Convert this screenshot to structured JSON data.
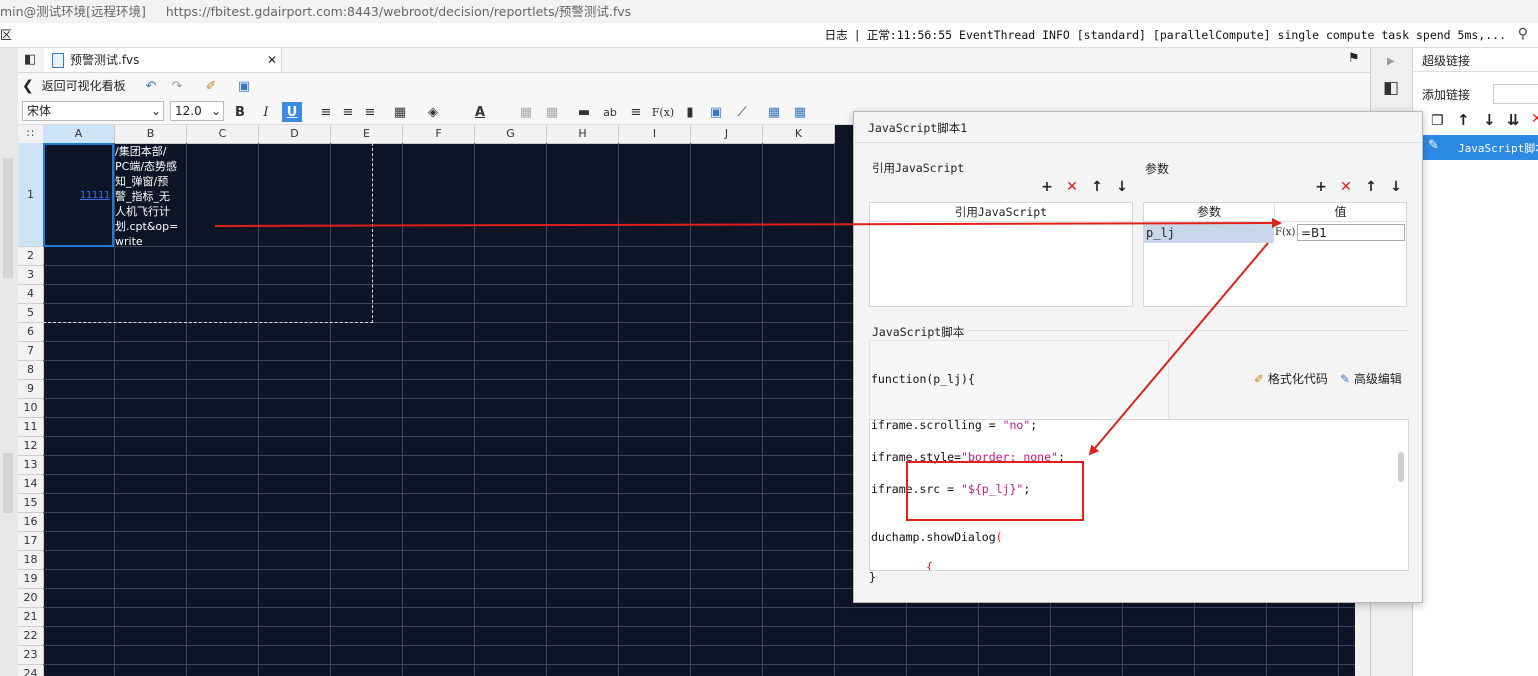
{
  "browser": {
    "title": "min@测试环境[远程环境]",
    "url": "https://fbitest.gdairport.com:8443/webroot/decision/reportlets/预警测试.fvs"
  },
  "titlebar": {
    "left_char": "区",
    "log_label": "日志",
    "log_text": "正常:11:56:55 EventThread INFO [standard] [parallelCompute] single compute task spend 5ms,..."
  },
  "tab": {
    "label": "预警测试.fvs"
  },
  "toolbar": {
    "back_label": "返回可视化看板",
    "font_name": "宋体",
    "font_size": "12.0",
    "bold": "B",
    "italic": "I",
    "underline": "U",
    "text_tool": "ab",
    "formula_tool": "F(x)"
  },
  "grid": {
    "columns": [
      "A",
      "B",
      "C",
      "D",
      "E",
      "F",
      "G",
      "H",
      "I",
      "J",
      "K"
    ],
    "rows": [
      "1",
      "2",
      "3",
      "4",
      "5",
      "6",
      "7",
      "8",
      "9",
      "10",
      "11",
      "12",
      "13",
      "14",
      "15",
      "16",
      "17",
      "18",
      "19",
      "20",
      "21",
      "22",
      "23",
      "24"
    ],
    "cell_a1": "11111",
    "cell_b1_lines": [
      "/集团本部/",
      "PC端/态势感",
      "知_弹窗/预",
      "警_指标_无",
      "人机飞行计",
      "划.cpt&op=",
      "write"
    ]
  },
  "hyperlink_panel": {
    "title": "超级链接",
    "add_label": "添加链接",
    "item_label": "JavaScript脚本"
  },
  "dialog": {
    "title": "JavaScript脚本1",
    "ref_section": "引用JavaScript",
    "ref_col": "引用JavaScript",
    "param_section": "参数",
    "param_col_name": "参数",
    "param_col_value": "值",
    "param_row": {
      "name": "p_lj",
      "value": "=B1",
      "fx": "F(x)"
    },
    "script_section": "JavaScript脚本",
    "function_sig": "function(p_lj){",
    "format_label": "格式化代码",
    "advanced_label": "高级编辑",
    "code": {
      "line1_pre": "iframe.scrolling = ",
      "line1_str": "\"no\"",
      "line1_post": ";",
      "line2_pre": "iframe.style=",
      "line2_str": "\"border: none\"",
      "line2_post": ";",
      "line3_pre": "iframe.src = ",
      "line3_str": "\"${p_lj}\"",
      "line3_post": ";",
      "line4_pre": "duchamp.showDialog",
      "line4_paren": "(",
      "line5_brace": "{",
      "closing": "}"
    }
  },
  "colors": {
    "grid_bg": "#0e1526",
    "annotation_red": "#e0201b",
    "selection_blue": "#1e7ad9"
  }
}
